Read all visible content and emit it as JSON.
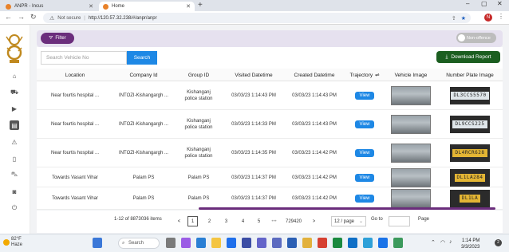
{
  "browser": {
    "tabs": [
      {
        "label": "ANPR - Incus"
      },
      {
        "label": "Home"
      }
    ],
    "new_tab": "+",
    "address": {
      "security": "Not secure",
      "url": "http://120.57.32.238/#/anpr/anpr"
    },
    "profile_initial": "N",
    "window_controls": {
      "minimize": "–",
      "maximize": "▢",
      "close": "✕"
    }
  },
  "topbar": {
    "filter_label": "Filter",
    "toggle_label": "Non-offence"
  },
  "toolbar": {
    "search_placeholder": "Search Vehicle No",
    "search_label": "Search",
    "download_label": "Download Report"
  },
  "table": {
    "columns": [
      "Location",
      "Company Id",
      "Group ID",
      "Visited Datetime",
      "Created Datetime",
      "Trajectory",
      "Vehicle Image",
      "Number Plate Image"
    ],
    "view_label": "View",
    "rows": [
      {
        "location": "Near fourtis hospital ...",
        "company": "INTOZI-Kishangargh ...",
        "group": "Kishanganj police station",
        "visited": "03/03/23 1:14:43 PM",
        "created": "03/03/23 1:14:43 PM",
        "plate": "DL3CCS5570",
        "plate_color": "white"
      },
      {
        "location": "Near fourtis hospital ...",
        "company": "INTOZI-Kishangargh ...",
        "group": "Kishanganj police station",
        "visited": "03/03/23 1:14:33 PM",
        "created": "03/03/23 1:14:43 PM",
        "plate": "DL9CCS225",
        "plate_color": "white"
      },
      {
        "location": "Near fourtis hospital ...",
        "company": "INTOZI-Kishangargh ...",
        "group": "Kishanganj police station",
        "visited": "03/03/23 1:14:35 PM",
        "created": "03/03/23 1:14:42 PM",
        "plate": "DL4RCR628",
        "plate_color": "yellow"
      },
      {
        "location": "Towards Vasant Vihar",
        "company": "Palam PS",
        "group": "Palam PS",
        "visited": "03/03/23 1:14:37 PM",
        "created": "03/03/23 1:14:42 PM",
        "plate": "DL1LA284",
        "plate_color": "yellow"
      },
      {
        "location": "Towards Vasant Vihar",
        "company": "Palam PS",
        "group": "Palam PS",
        "visited": "03/03/23 1:14:37 PM",
        "created": "03/03/23 1:14:42 PM",
        "plate": "DL1LA",
        "plate_color": "yellow"
      }
    ]
  },
  "pagination": {
    "summary": "1-12 of 8873036 items",
    "prev": "<",
    "pages": [
      "1",
      "2",
      "3",
      "4",
      "5"
    ],
    "ellipsis": "•••",
    "last_page": "729420",
    "next": ">",
    "page_size": "12 / page",
    "goto_label": "Go to",
    "page_label": "Page",
    "current_page": "1"
  },
  "taskbar": {
    "weather_temp": "82°F",
    "weather_desc": "Haze",
    "search_label": "Search",
    "time": "1:14 PM",
    "date": "3/3/2023",
    "notification_count": "2"
  },
  "colors": {
    "accent_purple": "#6b2d7c",
    "primary_blue": "#1e88e5",
    "download_green": "#1b5e20"
  }
}
